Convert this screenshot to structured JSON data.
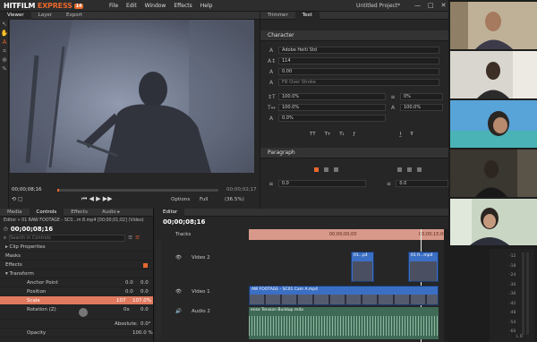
{
  "app": {
    "name_main": "HITFILM",
    "name_accent": "EXPRESS",
    "version": "14",
    "project_title": "Untitled Project*"
  },
  "menu": [
    "File",
    "Edit",
    "Window",
    "Effects",
    "Help"
  ],
  "window_controls": [
    "—",
    "□",
    "✕"
  ],
  "viewer_panel": {
    "tabs": [
      "Viewer",
      "Layer",
      "Export"
    ],
    "timecode_current": "00;00;08;16",
    "timecode_total": "00;00;02;17",
    "options_label": "Options",
    "full_label": "Full",
    "zoom_label": "(36.5%)"
  },
  "trimmer_panel": {
    "tabs": [
      "Trimmer",
      "Text"
    ],
    "character_title": "Character",
    "font": "Adobe Heiti Std",
    "size": "114",
    "weight": "0.00",
    "fill": "Fill Over Stroke",
    "scale_h": "100.0%",
    "scale_v": "100.0%",
    "tracking": "0.0%",
    "leading": "0%",
    "baseline": "100.0%",
    "style_buttons": [
      "TT",
      "Tт",
      "T₁",
      "ƒ"
    ],
    "paragraph_title": "Paragraph",
    "indent_value": "0.0",
    "space_value": "0.0"
  },
  "left_panel": {
    "tabs": [
      "Media",
      "Controls",
      "Effects",
      "Audio ▸"
    ],
    "clip_title": "Editor » 01 RAW FOOTAGE - SC0...m 8.mp4 [00;00;01;02] (Video)",
    "timecode": "00;00;08;16",
    "search_placeholder": "Search in Controls",
    "items": [
      {
        "label": "Clip Properties",
        "a": "",
        "b": ""
      },
      {
        "label": "Masks",
        "a": "",
        "b": ""
      },
      {
        "label": "Effects",
        "a": "",
        "b": ""
      },
      {
        "label": "Transform",
        "a": "",
        "b": ""
      },
      {
        "label": "Anchor Point",
        "a": "0.0",
        "b": "0.0"
      },
      {
        "label": "Position",
        "a": "0.0",
        "b": "0.0"
      },
      {
        "label": "Scale",
        "a": "107",
        "b": "107.0%"
      },
      {
        "label": "Rotation (Z)",
        "a": "0x",
        "b": "0.0"
      },
      {
        "label": "",
        "a": "Absolute:",
        "b": "0.0°"
      },
      {
        "label": "Opacity",
        "a": "",
        "b": "100.0 %"
      }
    ]
  },
  "editor_panel": {
    "tab": "Editor",
    "timecode": "00;00;08;16",
    "tracks_label": "Tracks",
    "ruler_label": "00;00;00;00",
    "ruler_right": "00;00;15;00",
    "video2": "Video 2",
    "video1": "Video 1",
    "audio2": "Audio 2",
    "clip_a": "01...p4",
    "clip_b": "01 R...mp4",
    "clip_main": "AW FOOTAGE - SC01 Cam A.mp4",
    "audio_clip": "ense Tension Buildup m4a",
    "meter_labels": [
      "-12",
      "-18",
      "-24",
      "-30",
      "-36",
      "-42",
      "-48",
      "-54",
      "-60"
    ],
    "meter_lr": "L   R"
  },
  "colors": {
    "accent": "#e8682c",
    "panel": "#262626",
    "header": "#333333",
    "clip_video": "#3b6fc4",
    "clip_audio": "#3e6a56",
    "scale_row": "#e07a5f"
  }
}
